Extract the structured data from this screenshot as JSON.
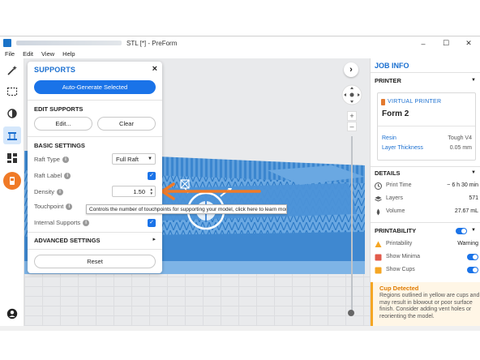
{
  "window": {
    "title": "STL [*] - PreForm",
    "minimize": "–",
    "maximize": "☐",
    "close": "✕"
  },
  "menu": [
    "File",
    "Edit",
    "View",
    "Help"
  ],
  "supports_panel": {
    "title": "SUPPORTS",
    "close": "×",
    "auto_generate": "Auto-Generate Selected",
    "edit_supports_heading": "EDIT SUPPORTS",
    "edit_button": "Edit...",
    "clear_button": "Clear",
    "basic_settings_heading": "BASIC SETTINGS",
    "raft_type_label": "Raft Type",
    "raft_type_value": "Full Raft",
    "raft_label_label": "Raft Label",
    "raft_label_checked": true,
    "density_label": "Density",
    "density_value": "1.50",
    "touchpoint_label": "Touchpoint",
    "internal_supports_label": "Internal Supports",
    "internal_supports_checked": true,
    "advanced_settings_heading": "ADVANCED SETTINGS",
    "reset_button": "Reset"
  },
  "tooltip": "Controls the number of touchpoints for supporting your model, click here to learn more.",
  "job_info": {
    "title": "JOB INFO",
    "printer_heading": "PRINTER",
    "virtual_printer_label": "VIRTUAL PRINTER",
    "printer_name": "Form 2",
    "resin_label": "Resin",
    "resin_value": "Tough V4",
    "layer_thickness_label": "Layer Thickness",
    "layer_thickness_value": "0.05 mm",
    "details_heading": "DETAILS",
    "print_time_label": "Print Time",
    "print_time_value": "~ 6 h 30 min",
    "layers_label": "Layers",
    "layers_value": "571",
    "volume_label": "Volume",
    "volume_value": "27.67 mL",
    "printability_heading": "PRINTABILITY",
    "printability_label": "Printability",
    "printability_value": "Warning",
    "show_minima_label": "Show Minima",
    "show_minima_on": true,
    "show_cups_label": "Show Cups",
    "show_cups_on": true,
    "cup_detected_title": "Cup Detected",
    "cup_detected_text": "Regions outlined in yellow are cups and may result in blowout or poor surface finish. Consider adding vent holes or reorienting the model."
  },
  "colors": {
    "accent": "#1a73e8",
    "heading_blue": "#1a6fd0",
    "model_blue": "#3d8bd4",
    "orange_arrow": "#f07a27",
    "warning_orange": "#f5a623"
  }
}
